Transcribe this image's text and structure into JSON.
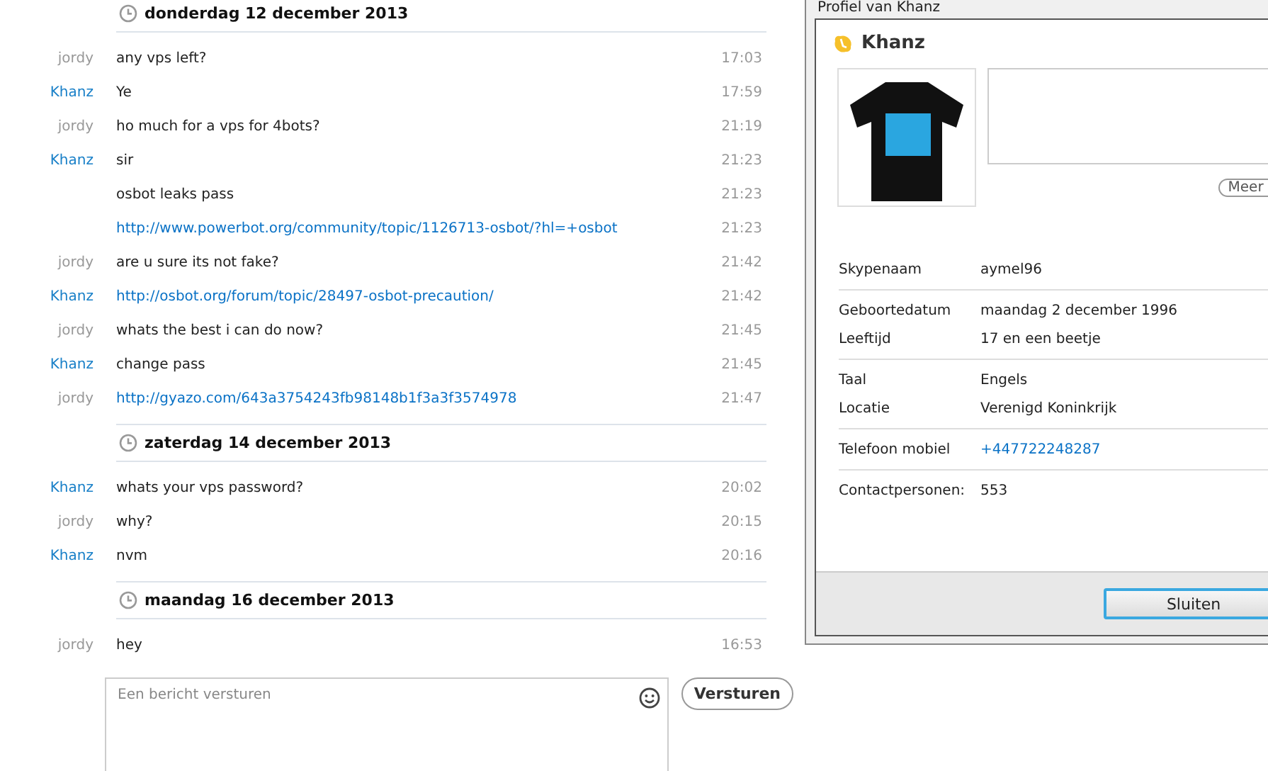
{
  "conversation": [
    {
      "date": "donderdag 12 december 2013",
      "messages": [
        {
          "sender": "jordy",
          "color": "#999999",
          "kind": "text",
          "text": "any vps left?",
          "time": "17:03"
        },
        {
          "sender": "Khanz",
          "color": "#1a80c8",
          "kind": "text",
          "text": "Ye",
          "time": "17:59"
        },
        {
          "sender": "jordy",
          "color": "#999999",
          "kind": "text",
          "text": "ho much for a vps for 4bots?",
          "time": "21:19"
        },
        {
          "sender": "Khanz",
          "color": "#1a80c8",
          "kind": "text",
          "text": "sir",
          "time": "21:23"
        },
        {
          "kind": "text",
          "text": "osbot leaks pass",
          "time": "21:23"
        },
        {
          "kind": "link",
          "text": "http://www.powerbot.org/community/topic/1126713-osbot/?hl=+osbot",
          "time": "21:23"
        },
        {
          "sender": "jordy",
          "color": "#999999",
          "kind": "text",
          "text": "are u sure its not fake?",
          "time": "21:42"
        },
        {
          "sender": "Khanz",
          "color": "#1a80c8",
          "kind": "link",
          "text": "http://osbot.org/forum/topic/28497-osbot-precaution/",
          "time": "21:42"
        },
        {
          "sender": "jordy",
          "color": "#999999",
          "kind": "text",
          "text": "whats the best i can do now?",
          "time": "21:45"
        },
        {
          "sender": "Khanz",
          "color": "#1a80c8",
          "kind": "text",
          "text": "change pass",
          "time": "21:45"
        },
        {
          "sender": "jordy",
          "color": "#999999",
          "kind": "link",
          "text": "http://gyazo.com/643a3754243fb98148b1f3a3f3574978",
          "time": "21:47"
        }
      ]
    },
    {
      "date": "zaterdag 14 december 2013",
      "messages": [
        {
          "sender": "Khanz",
          "color": "#1a80c8",
          "kind": "text",
          "text": "whats your vps password?",
          "time": "20:02"
        },
        {
          "sender": "jordy",
          "color": "#999999",
          "kind": "text",
          "text": "why?",
          "time": "20:15"
        },
        {
          "sender": "Khanz",
          "color": "#1a80c8",
          "kind": "text",
          "text": "nvm",
          "time": "20:16"
        }
      ]
    },
    {
      "date": "maandag 16 december 2013",
      "messages": [
        {
          "sender": "jordy",
          "color": "#999999",
          "kind": "text",
          "text": "hey",
          "time": "16:53"
        }
      ]
    }
  ],
  "composer": {
    "placeholder": "Een bericht versturen",
    "send_button": "Versturen"
  },
  "profile_window": {
    "title": "Profiel van Khanz",
    "name": "Khanz",
    "more_button": "Meer",
    "groups": [
      [
        {
          "label": "Skypenaam",
          "value": "aymel96",
          "kind": "text"
        }
      ],
      [
        {
          "label": "Geboortedatum",
          "value": "maandag 2 december 1996",
          "kind": "text"
        },
        {
          "label": "Leeftijd",
          "value": "17 en een beetje",
          "kind": "text"
        }
      ],
      [
        {
          "label": "Taal",
          "value": "Engels",
          "kind": "text"
        },
        {
          "label": "Locatie",
          "value": "Verenigd Koninkrijk",
          "kind": "text"
        }
      ],
      [
        {
          "label": "Telefoon mobiel",
          "value": "+447722248287",
          "kind": "link"
        }
      ],
      [
        {
          "label": "Contactpersonen:",
          "value": "553",
          "kind": "text"
        }
      ]
    ],
    "close_button": "Sluiten"
  }
}
